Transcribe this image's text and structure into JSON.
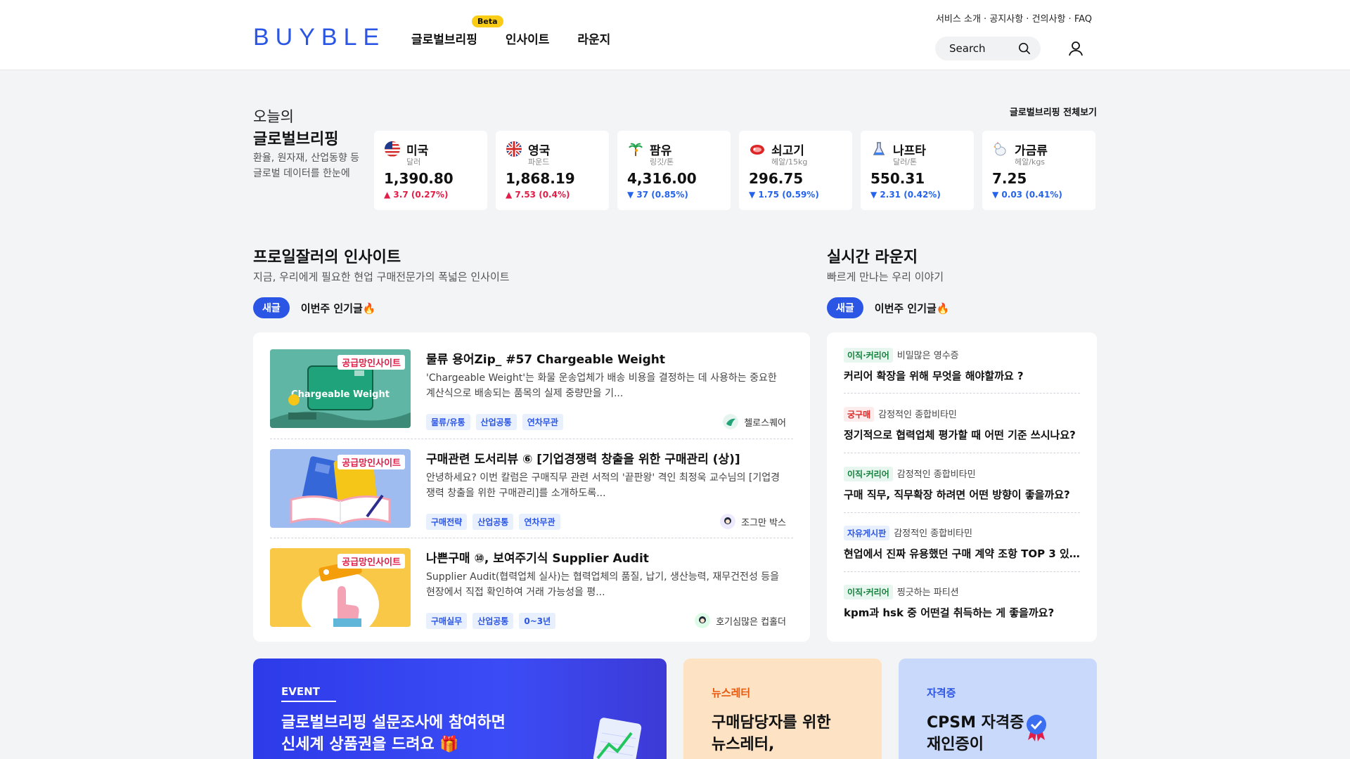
{
  "header": {
    "logo": "BUYBLE",
    "nav": [
      {
        "label": "글로벌브리핑",
        "badge": "Beta"
      },
      {
        "label": "인사이트"
      },
      {
        "label": "라운지"
      }
    ],
    "util_links": [
      "서비스 소개",
      "공지사항",
      "건의사항",
      "FAQ"
    ],
    "search_placeholder": "Search"
  },
  "briefing": {
    "subtitle": "오늘의",
    "title": "글로벌브리핑",
    "desc_line1": "환율, 원자재, 산업동향 등",
    "desc_line2": "글로벌 데이터를 한눈에",
    "view_all": "글로벌브리핑 전체보기",
    "cards": [
      {
        "name": "미국",
        "unit": "달러",
        "value": "1,390.80",
        "change": "3.7 (0.27%)",
        "dir": "up",
        "icon": "us-flag-icon"
      },
      {
        "name": "영국",
        "unit": "파운드",
        "value": "1,868.19",
        "change": "7.53 (0.4%)",
        "dir": "up",
        "icon": "uk-flag-icon"
      },
      {
        "name": "팜유",
        "unit": "링깃/톤",
        "value": "4,316.00",
        "change": "37 (0.85%)",
        "dir": "down",
        "icon": "palm-icon"
      },
      {
        "name": "쇠고기",
        "unit": "헤알/15kg",
        "value": "296.75",
        "change": "1.75 (0.59%)",
        "dir": "down",
        "icon": "beef-icon"
      },
      {
        "name": "나프타",
        "unit": "달러/톤",
        "value": "550.31",
        "change": "2.31 (0.42%)",
        "dir": "down",
        "icon": "flask-icon"
      },
      {
        "name": "가금류",
        "unit": "헤알/kgs",
        "value": "7.25",
        "change": "0.03 (0.41%)",
        "dir": "down",
        "icon": "chicken-icon"
      }
    ],
    "arrow_up": "▲",
    "arrow_down": "▼"
  },
  "insight": {
    "title": "프로일잘러의 인사이트",
    "desc": "지금, 우리에게 필요한 현업 구매전문가의 폭넓은 인사이트",
    "tab_new": "새글",
    "tab_popular": "이번주 인기글🔥",
    "articles": [
      {
        "thumb_tag": "공급망인사이트",
        "thumb_text": "Chargeable Weight",
        "title": "물류 용어Zip_ #57 Chargeable Weight",
        "body": "'Chargeable Weight'는 화물 운송업체가 배송 비용을 결정하는 데 사용하는 중요한 계산식으로 배송되는 품목의 실제 중량만을 기...",
        "tags": [
          "물류/유통",
          "산업공통",
          "연차무관"
        ],
        "author": "첼로스퀘어"
      },
      {
        "thumb_tag": "공급망인사이트",
        "title": "구매관련 도서리뷰 ⑥ [기업경쟁력 창출을 위한 구매관리 (상)]",
        "body": "안녕하세요? 이번 칼럼은 구매직무 관련 서적의 '끝판왕' 격인 최정욱 교수님의 [기업경쟁력 창출을 위한 구매관리]를 소개하도록...",
        "tags": [
          "구매전략",
          "산업공통",
          "연차무관"
        ],
        "author": "조그만 박스"
      },
      {
        "thumb_tag": "공급망인사이트",
        "title": "나쁜구매 ⑩, 보여주기식 Supplier Audit",
        "body": "Supplier Audit(협력업체 실사)는 협력업체의 품질, 납기, 생산능력, 재무건전성 등을 현장에서 직접 확인하여 거래 가능성을 평...",
        "tags": [
          "구매실무",
          "산업공통",
          "0~3년"
        ],
        "author": "호기심많은 컵홀더"
      }
    ]
  },
  "lounge": {
    "title": "실시간 라운지",
    "desc": "빠르게 만나는 우리 이야기",
    "tab_new": "새글",
    "tab_popular": "이번주 인기글🔥",
    "items": [
      {
        "category": "이직·커리어",
        "cat_color": "green",
        "author": "비밀많은 영수증",
        "question": "커리어 확장을 위해 무엇을 해야할까요 ?"
      },
      {
        "category": "궁구매",
        "cat_color": "red",
        "author": "감정적인 종합비타민",
        "question": "정기적으로 협력업체 평가할 때 어떤 기준 쓰시나요?"
      },
      {
        "category": "이직·커리어",
        "cat_color": "green",
        "author": "감정적인 종합비타민",
        "question": "구매 직무, 직무확장 하려면 어떤 방향이 좋을까요?"
      },
      {
        "category": "자유게시판",
        "cat_color": "blue",
        "author": "감정적인 종합비타민",
        "question": "현업에서 진짜 유용했던 구매 계약 조항 TOP 3 있으..."
      },
      {
        "category": "이직·커리어",
        "cat_color": "green",
        "author": "찡긋하는 파티션",
        "question": "kpm과 hsk 중 어떤걸 취득하는 게 좋을까요?"
      }
    ]
  },
  "banners": {
    "event": {
      "label": "EVENT",
      "line1": "글로벌브리핑 설문조사에 참여하면",
      "line2": "신세계 상품권을 드려요 🎁"
    },
    "news": {
      "label": "뉴스레터",
      "line1": "구매담당자를 위한",
      "line2": "뉴스레터,"
    },
    "cert": {
      "label": "자격증",
      "line1": "CPSM 자격증",
      "line2": "재인증이"
    }
  },
  "colors": {
    "brand": "#2a55e5",
    "up": "#e11d48",
    "down": "#2563eb"
  }
}
